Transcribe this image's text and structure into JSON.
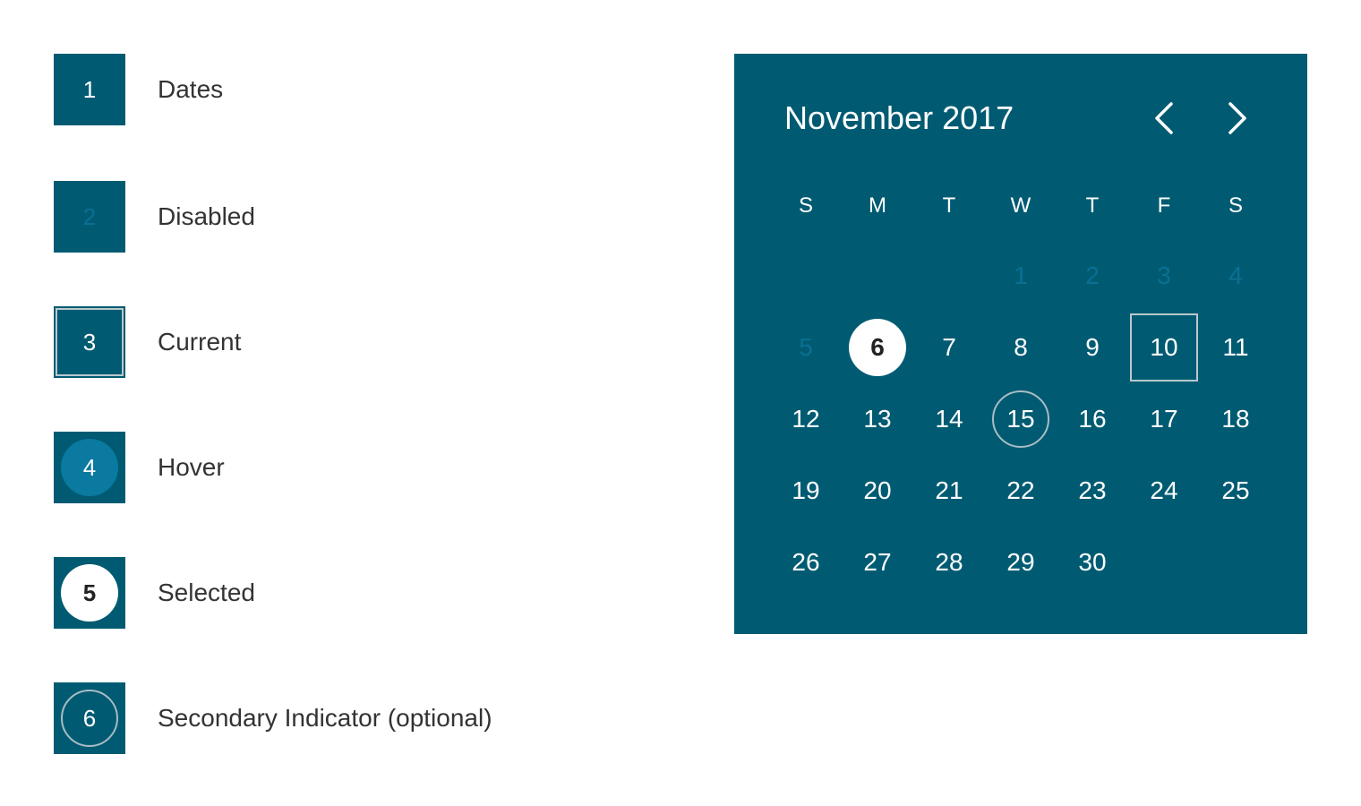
{
  "legend": {
    "items": [
      {
        "number": "1",
        "label": "Dates"
      },
      {
        "number": "2",
        "label": "Disabled"
      },
      {
        "number": "3",
        "label": "Current"
      },
      {
        "number": "4",
        "label": "Hover"
      },
      {
        "number": "5",
        "label": "Selected"
      },
      {
        "number": "6",
        "label": "Secondary Indicator (optional)"
      }
    ]
  },
  "calendar": {
    "title": "November 2017",
    "prev_icon": "chevron-left-icon",
    "next_icon": "chevron-right-icon",
    "weekdays": [
      "S",
      "M",
      "T",
      "W",
      "T",
      "F",
      "S"
    ],
    "weeks": [
      [
        "",
        "",
        "",
        "1",
        "2",
        "3",
        "4"
      ],
      [
        "5",
        "6",
        "7",
        "8",
        "9",
        "10",
        "11"
      ],
      [
        "12",
        "13",
        "14",
        "15",
        "16",
        "17",
        "18"
      ],
      [
        "19",
        "20",
        "21",
        "22",
        "23",
        "24",
        "25"
      ],
      [
        "26",
        "27",
        "28",
        "29",
        "30",
        "",
        ""
      ]
    ],
    "disabled_days": [
      "1",
      "2",
      "3",
      "4",
      "5"
    ],
    "selected_day": "6",
    "current_day": "10",
    "secondary_day": "15"
  },
  "colors": {
    "panel": "#005b72",
    "disabled_text": "#0b6f93",
    "hover": "#0a7aa0",
    "selected_fill": "#ffffff",
    "current_border": "#b9c8cd",
    "label_text": "#333333"
  }
}
